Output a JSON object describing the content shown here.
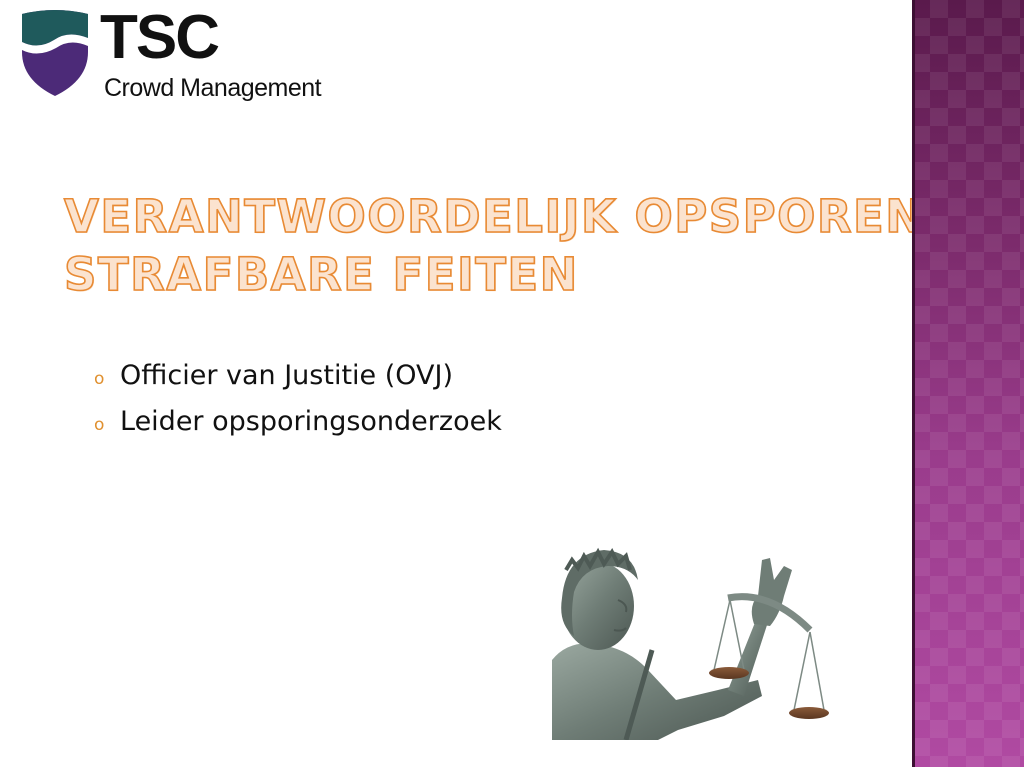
{
  "logo": {
    "name": "TSC",
    "subtitle": "Crowd Management",
    "colors": {
      "top": "#1f5a5c",
      "wave": "#ffffff",
      "bottom": "#4c2a78"
    }
  },
  "title": {
    "line1": "Verantwoordelijk opsporen",
    "line2": "strafbare feiten"
  },
  "bullets": [
    {
      "marker": "o",
      "text": "Officier van Justitie (OVJ)"
    },
    {
      "marker": "o",
      "text": "Leider opsporingsonderzoek"
    }
  ],
  "image": {
    "subject": "lady-justice-statue-with-scales"
  },
  "theme": {
    "accent": "#e88a34",
    "band_top": "#5a1a4c",
    "band_bottom": "#b04aa2"
  }
}
